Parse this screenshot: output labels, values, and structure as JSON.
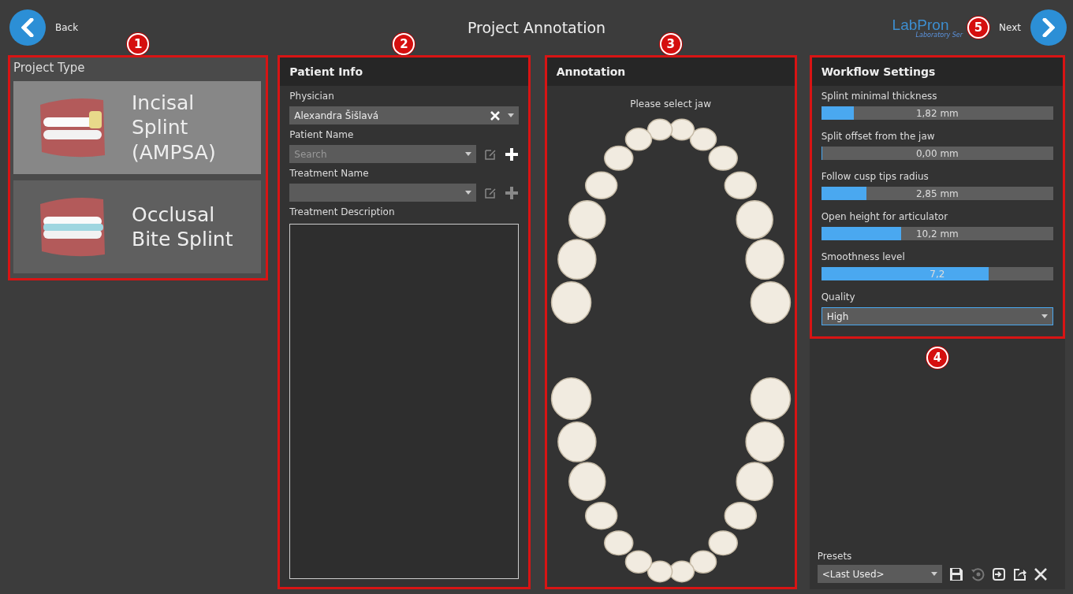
{
  "top_bar": {
    "back": "Back",
    "title": "Project Annotation",
    "logo": "LabPron",
    "logo_subtitle": "Laboratory Ser",
    "next": "Next"
  },
  "callouts": [
    "1",
    "2",
    "3",
    "4",
    "5"
  ],
  "project_type": {
    "title": "Project Type",
    "items": [
      {
        "label": "Incisal Splint (AMPSA)",
        "kind": "incisal",
        "selected": true
      },
      {
        "label": "Occlusal Bite Splint",
        "kind": "occlusal",
        "selected": false
      }
    ]
  },
  "patient_info": {
    "title": "Patient Info",
    "fields": [
      {
        "label": "Physician",
        "kind": "clearable",
        "value": "Alexandra Šišlavá"
      },
      {
        "label": "Patient Name",
        "kind": "editable",
        "placeholder": "Search",
        "add_enabled": true
      },
      {
        "label": "Treatment Name",
        "kind": "editable",
        "add_enabled": false
      }
    ],
    "description": {
      "label": "Treatment Description"
    }
  },
  "annotation": {
    "title": "Annotation",
    "prompt": "Please select jaw"
  },
  "workflow_settings": {
    "title": "Workflow Settings",
    "sliders": [
      {
        "label": "Splint minimal thickness",
        "reading": "1,82 mm",
        "level": 0.14
      },
      {
        "label": "Split offset from the jaw",
        "reading": "0,00 mm",
        "level": 0.0
      },
      {
        "label": "Follow cusp tips radius",
        "reading": "2,85 mm",
        "level": 0.195
      },
      {
        "label": "Open height for articulator",
        "reading": "10,2 mm",
        "level": 0.345
      },
      {
        "label": "Smoothness level",
        "reading": "7,2",
        "level": 0.72
      }
    ],
    "quality": {
      "label": "Quality",
      "value": "High"
    }
  },
  "presets": {
    "label": "Presets",
    "value": "<Last Used>",
    "actions": [
      {
        "kind": "save",
        "disabled": false
      },
      {
        "kind": "revert",
        "disabled": true
      },
      {
        "kind": "import",
        "disabled": false
      },
      {
        "kind": "export",
        "disabled": false
      },
      {
        "kind": "delete",
        "disabled": false
      }
    ]
  }
}
